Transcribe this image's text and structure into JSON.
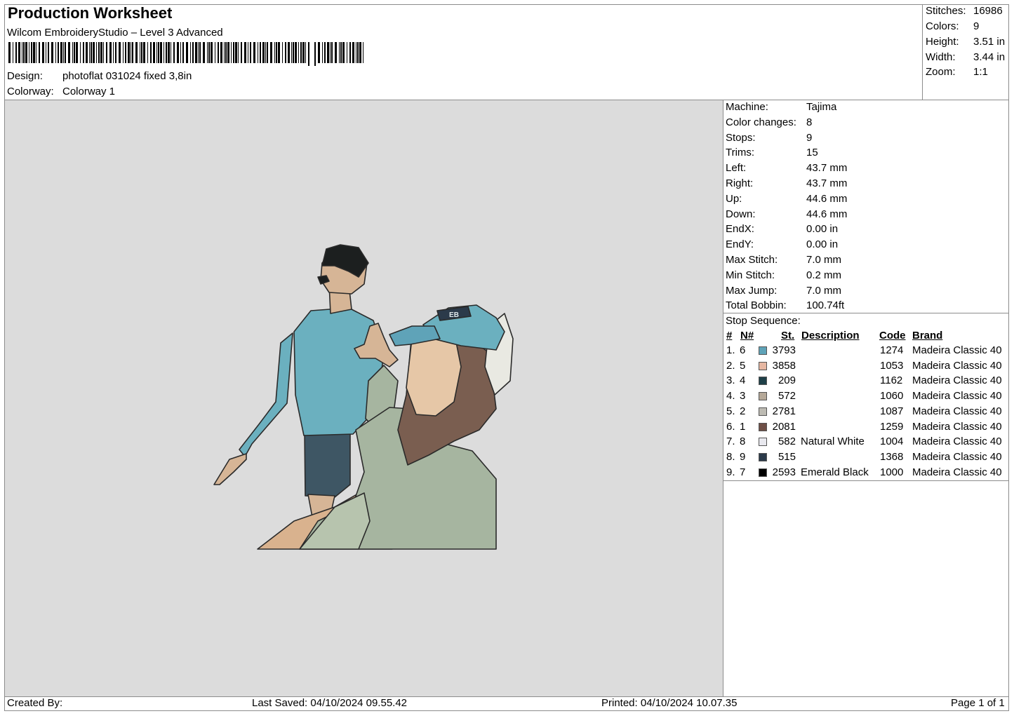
{
  "header": {
    "title": "Production Worksheet",
    "subtitle": "Wilcom EmbroideryStudio – Level 3 Advanced",
    "design_label": "Design:",
    "design_value": "photoflat 031024 fixed 3,8in",
    "colorway_label": "Colorway:",
    "colorway_value": "Colorway 1"
  },
  "summary": [
    {
      "label": "Stitches:",
      "value": "16986"
    },
    {
      "label": "Colors:",
      "value": "9"
    },
    {
      "label": "Height:",
      "value": "3.51 in"
    },
    {
      "label": "Width:",
      "value": "3.44 in"
    },
    {
      "label": "Zoom:",
      "value": "1:1"
    }
  ],
  "specs": [
    {
      "label": "Machine:",
      "value": "Tajima"
    },
    {
      "label": "Color changes:",
      "value": "8"
    },
    {
      "label": "Stops:",
      "value": "9"
    },
    {
      "label": "Trims:",
      "value": "15"
    },
    {
      "label": "Left:",
      "value": "43.7 mm"
    },
    {
      "label": "Right:",
      "value": "43.7 mm"
    },
    {
      "label": "Up:",
      "value": "44.6 mm"
    },
    {
      "label": "Down:",
      "value": "44.6 mm"
    },
    {
      "label": "EndX:",
      "value": "0.00 in"
    },
    {
      "label": "EndY:",
      "value": "0.00 in"
    },
    {
      "label": "Max Stitch:",
      "value": "7.0 mm"
    },
    {
      "label": "Min Stitch:",
      "value": "0.2 mm"
    },
    {
      "label": "Max Jump:",
      "value": "7.0 mm"
    },
    {
      "label": "Total Bobbin:",
      "value": "100.74ft"
    }
  ],
  "stop_sequence": {
    "title": "Stop Sequence:",
    "headers": {
      "num": "#",
      "n": "N#",
      "st": "St.",
      "desc": "Description",
      "code": "Code",
      "brand": "Brand"
    },
    "rows": [
      {
        "idx": "1.",
        "n": "6",
        "color": "#5fa3b8",
        "st": "3793",
        "desc": "",
        "code": "1274",
        "brand": "Madeira Classic 40"
      },
      {
        "idx": "2.",
        "n": "5",
        "color": "#e6b7a2",
        "st": "3858",
        "desc": "",
        "code": "1053",
        "brand": "Madeira Classic 40"
      },
      {
        "idx": "3.",
        "n": "4",
        "color": "#1e4048",
        "st": "209",
        "desc": "",
        "code": "1162",
        "brand": "Madeira Classic 40"
      },
      {
        "idx": "4.",
        "n": "3",
        "color": "#b5a898",
        "st": "572",
        "desc": "",
        "code": "1060",
        "brand": "Madeira Classic 40"
      },
      {
        "idx": "5.",
        "n": "2",
        "color": "#bdbbb3",
        "st": "2781",
        "desc": "",
        "code": "1087",
        "brand": "Madeira Classic 40"
      },
      {
        "idx": "6.",
        "n": "1",
        "color": "#6e4f46",
        "st": "2081",
        "desc": "",
        "code": "1259",
        "brand": "Madeira Classic 40"
      },
      {
        "idx": "7.",
        "n": "8",
        "color": "#e8e8ee",
        "st": "582",
        "desc": "Natural White",
        "code": "1004",
        "brand": "Madeira Classic 40"
      },
      {
        "idx": "8.",
        "n": "9",
        "color": "#2b3a4a",
        "st": "515",
        "desc": "",
        "code": "1368",
        "brand": "Madeira Classic 40"
      },
      {
        "idx": "9.",
        "n": "7",
        "color": "#000000",
        "st": "2593",
        "desc": "Emerald Black",
        "code": "1000",
        "brand": "Madeira Classic 40"
      }
    ]
  },
  "footer": {
    "created_by": "Created By:",
    "last_saved": "Last Saved: 04/10/2024 09.55.42",
    "printed": "Printed: 04/10/2024 10.07.35",
    "page": "Page 1 of 1"
  },
  "artwork": {
    "hat_text": "EB"
  }
}
